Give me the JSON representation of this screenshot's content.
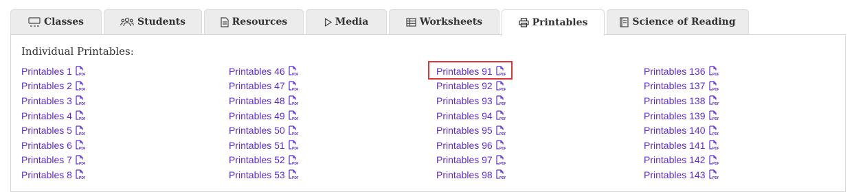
{
  "tabs": [
    {
      "label": "Classes",
      "icon": "classroom-icon",
      "active": false
    },
    {
      "label": "Students",
      "icon": "users-icon",
      "active": false
    },
    {
      "label": "Resources",
      "icon": "document-icon",
      "active": false
    },
    {
      "label": "Media",
      "icon": "play-icon",
      "active": false
    },
    {
      "label": "Worksheets",
      "icon": "table-icon",
      "active": false
    },
    {
      "label": "Printables",
      "icon": "printer-icon",
      "active": true
    },
    {
      "label": "Science of Reading",
      "icon": "book-icon",
      "active": false
    }
  ],
  "section": {
    "heading": "Individual Printables:"
  },
  "columns": [
    [
      "Printables 1",
      "Printables 2",
      "Printables 3",
      "Printables 4",
      "Printables 5",
      "Printables 6",
      "Printables 7",
      "Printables 8"
    ],
    [
      "Printables 46",
      "Printables 47",
      "Printables 48",
      "Printables 49",
      "Printables 50",
      "Printables 51",
      "Printables 52",
      "Printables 53"
    ],
    [
      "Printables 91",
      "Printables 92",
      "Printables 93",
      "Printables 94",
      "Printables 95",
      "Printables 96",
      "Printables 97",
      "Printables 98"
    ],
    [
      "Printables 136",
      "Printables 137",
      "Printables 138",
      "Printables 139",
      "Printables 140",
      "Printables 141",
      "Printables 142",
      "Printables 143"
    ]
  ],
  "highlighted_item": "Printables 91",
  "file_icon": "pdf-file-icon",
  "colors": {
    "link": "#5b2ad6",
    "highlight": "#e03434",
    "tab_bg": "#ececec"
  }
}
